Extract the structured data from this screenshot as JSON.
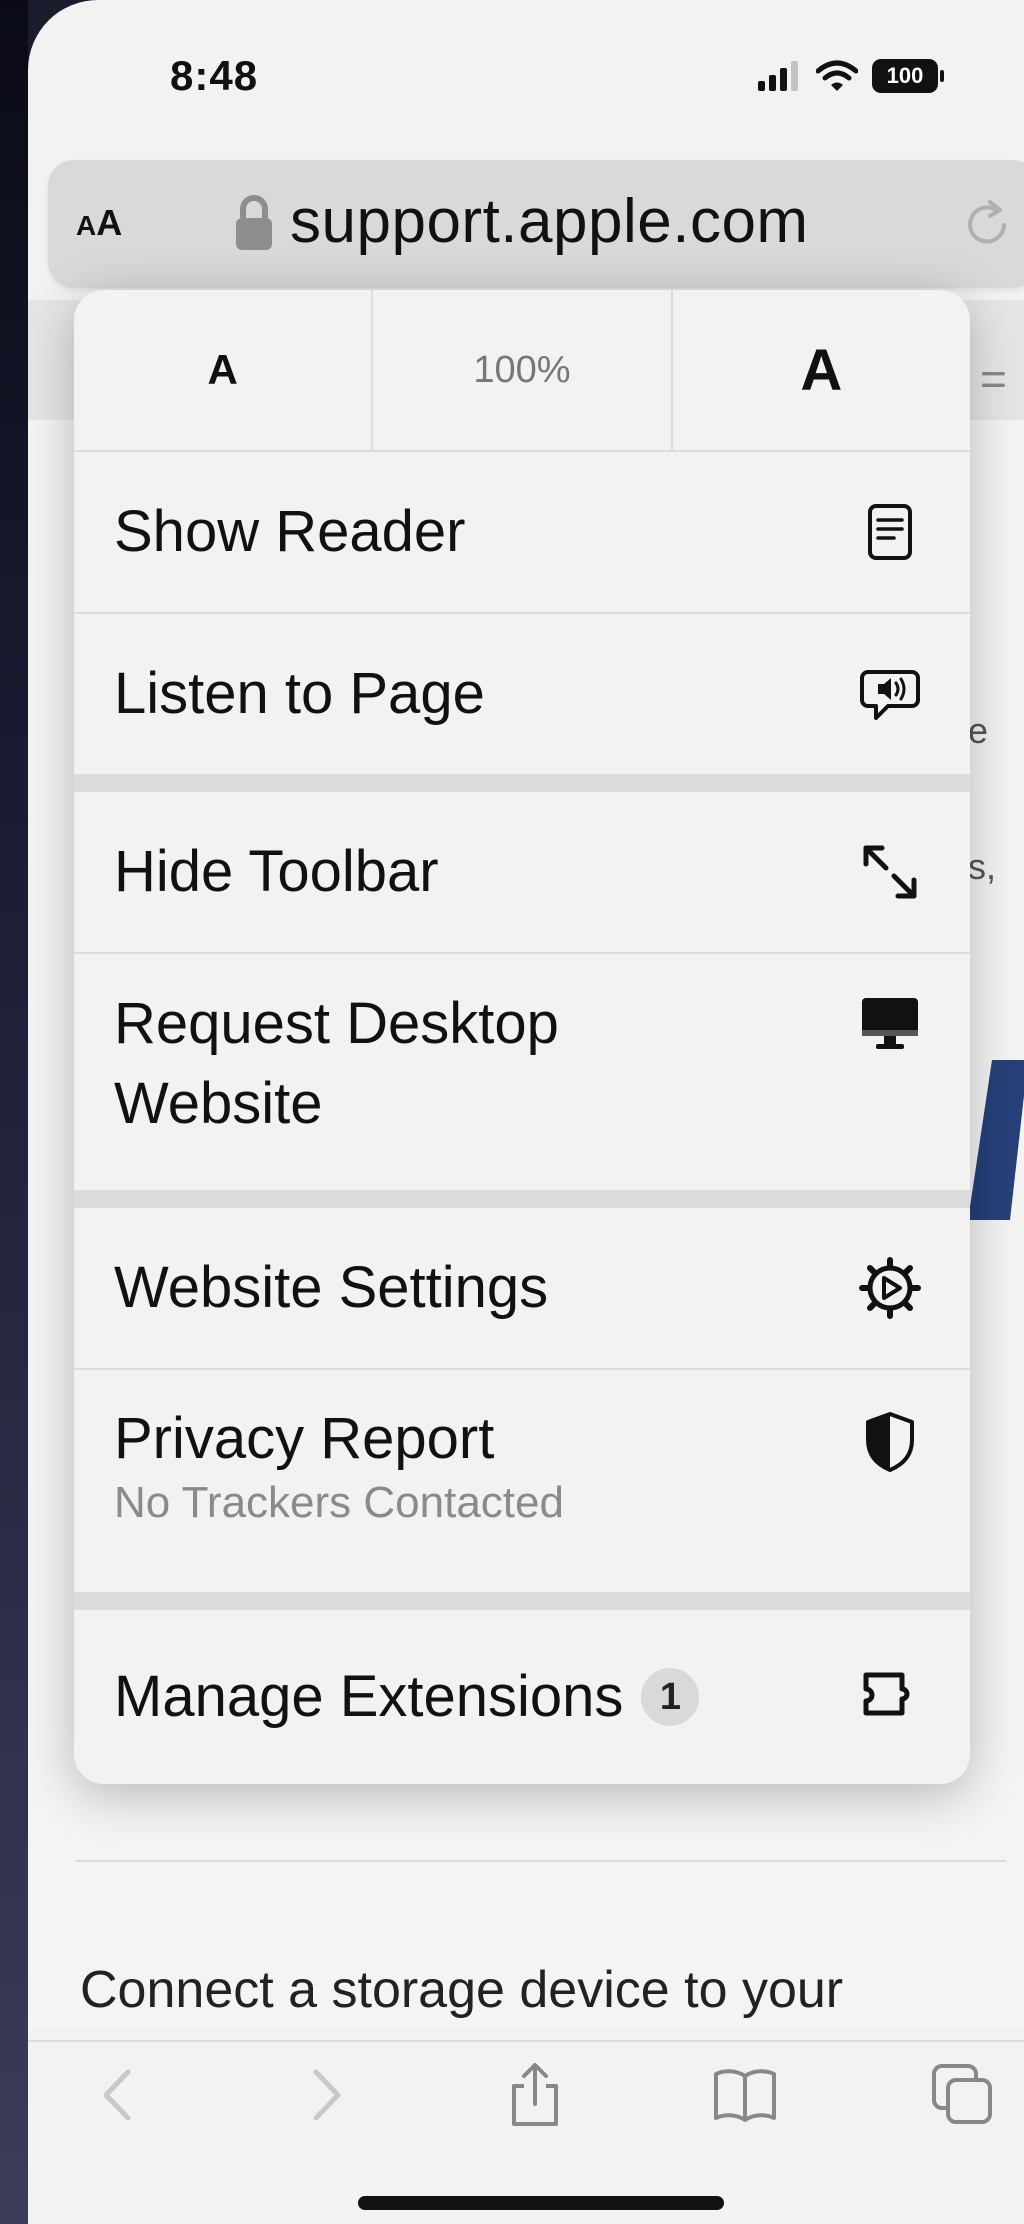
{
  "status_bar": {
    "time": "8:48",
    "battery": "100"
  },
  "address_bar": {
    "aa_label_small": "A",
    "aa_label_large": "A",
    "url": "support.apple.com"
  },
  "page": {
    "peek_text_1": "e",
    "peek_text_2": "s,",
    "peek_menu": "=",
    "paragraph": "Connect a storage device to your"
  },
  "menu": {
    "font_smaller": "A",
    "zoom_level": "100%",
    "font_larger": "A",
    "items": [
      {
        "label": "Show Reader",
        "icon": "reader-icon"
      },
      {
        "label": "Listen to Page",
        "icon": "speech-bubble-icon"
      },
      {
        "label": "Hide Toolbar",
        "icon": "expand-arrows-icon"
      },
      {
        "label": "Request Desktop Website",
        "label_line1": "Request Desktop",
        "label_line2": "Website",
        "icon": "desktop-icon"
      },
      {
        "label": "Website Settings",
        "icon": "gear-icon"
      },
      {
        "label": "Privacy Report",
        "sublabel": "No Trackers Contacted",
        "icon": "shield-icon"
      },
      {
        "label": "Manage Extensions",
        "badge": "1",
        "icon": "extension-icon"
      }
    ]
  },
  "toolbar": {
    "icons": [
      "back-icon",
      "forward-icon",
      "share-icon",
      "bookmarks-icon",
      "tabs-icon"
    ]
  },
  "colors": {
    "menu_background": "#f2f2f2",
    "separator": "#dcdcdc",
    "text": "#111111",
    "secondary_text": "#8a8a8a",
    "toolbar_icon_disabled": "#c8c8c8",
    "toolbar_icon": "#888888"
  }
}
